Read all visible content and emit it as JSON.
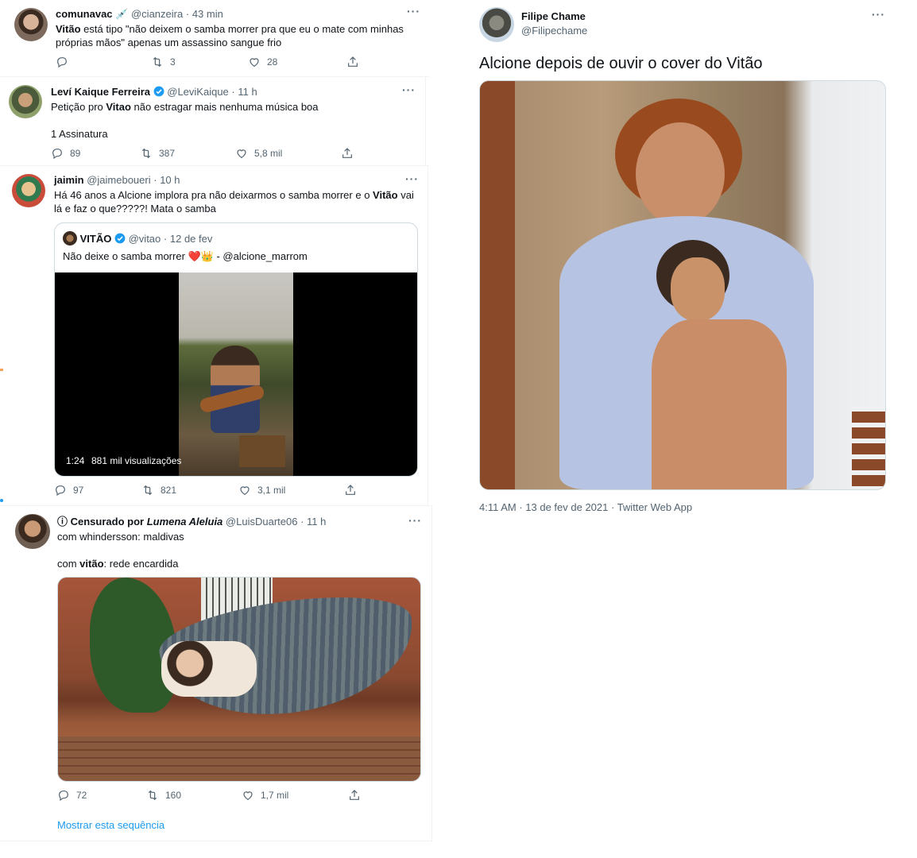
{
  "tweets": {
    "t1": {
      "name": "comunavac",
      "emoji": "💉",
      "handle": "@cianzeira",
      "time": "43 min",
      "bold": "Vitão",
      "text": " está tipo \"não deixem o samba morrer pra que eu o mate com minhas próprias mãos\" apenas um assassino sangue frio",
      "replies": "",
      "retweets": "3",
      "likes": "28"
    },
    "t2": {
      "name": "Leví Kaique Ferreira",
      "handle": "@LeviKaique",
      "time": "11 h",
      "text_a": "Petição pro ",
      "bold": "Vitao",
      "text_b": " não estragar mais nenhuma música boa",
      "text_c": "1 Assinatura",
      "replies": "89",
      "retweets": "387",
      "likes": "5,8 mil"
    },
    "t3": {
      "name": "jaimin",
      "handle": "@jaimeboueri",
      "time": "10 h",
      "text_a": "Há 46 anos a Alcione implora pra não deixarmos o samba morrer e o ",
      "bold": "Vitão",
      "text_b": " vai lá e faz o que?????! Mata o samba",
      "quote": {
        "name": "VITÃO",
        "handle": "@vitao",
        "date": "12 de fev",
        "text": "Não deixe o samba morrer ❤️👑 - @alcione_marrom",
        "duration": "1:24",
        "views": "881 mil visualizações"
      },
      "replies": "97",
      "retweets": "821",
      "likes": "3,1 mil"
    },
    "t4": {
      "prefix": "ⓘ Censurado por ",
      "name_italic": "Lumena Aleluia",
      "handle": "@LuisDuarte06",
      "time": "11 h",
      "line1": "com whindersson: maldivas",
      "line2_a": "com ",
      "line2_bold": "vitão",
      "line2_b": ": rede encardida",
      "replies": "72",
      "retweets": "160",
      "likes": "1,7 mil",
      "thread_link": "Mostrar esta sequência"
    },
    "main": {
      "name": "Filipe Chame",
      "handle": "@Filipechame",
      "text": "Alcione depois de ouvir o cover do Vitão",
      "footer": "4:11 AM · 13 de fev de 2021 · Twitter Web App"
    }
  },
  "colors": {
    "accent": "#1d9bf0",
    "muted": "#536471",
    "like": "#536471"
  }
}
